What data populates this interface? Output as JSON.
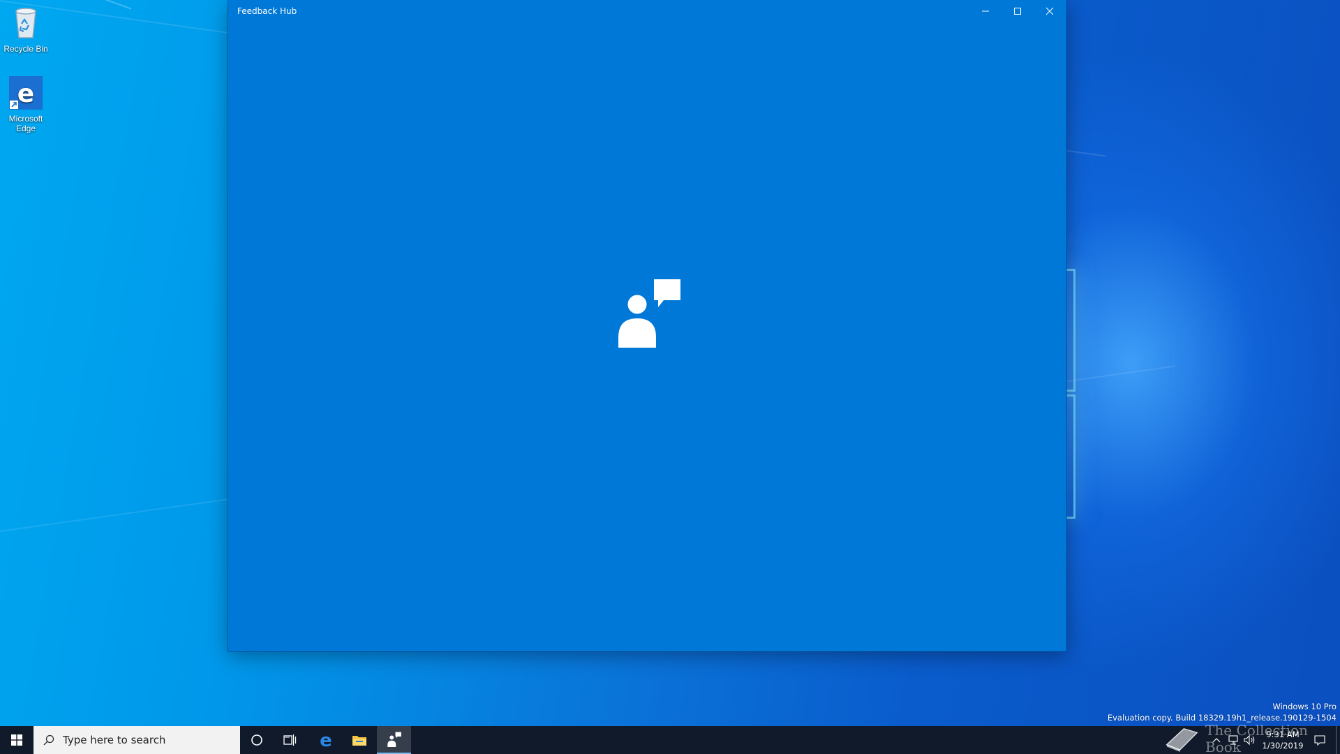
{
  "desktop": {
    "icons": [
      {
        "label": "Recycle Bin",
        "icon": "recycle-bin-icon"
      },
      {
        "label": "Microsoft Edge",
        "icon": "edge-icon"
      }
    ],
    "watermark": {
      "edition": "Windows 10 Pro",
      "build": "Evaluation copy. Build 18329.19h1_release.190129-1504"
    },
    "overlay_logo_text": "The Collection Book"
  },
  "window": {
    "title": "Feedback Hub",
    "background_color": "#0078d7",
    "buttons": {
      "minimize": "minimize-icon",
      "maximize": "maximize-icon",
      "close": "close-icon"
    },
    "splash_icon": "feedback-hub-logo-icon"
  },
  "taskbar": {
    "start_icon": "windows-start-icon",
    "search_placeholder": "Type here to search",
    "items": [
      {
        "name": "cortana",
        "icon": "cortana-circle-icon"
      },
      {
        "name": "task-view",
        "icon": "task-view-icon"
      },
      {
        "name": "edge",
        "icon": "edge-icon"
      },
      {
        "name": "file-explorer",
        "icon": "folder-icon"
      },
      {
        "name": "feedback-hub",
        "icon": "feedback-hub-icon",
        "active": true
      }
    ],
    "tray": {
      "time": "9:31 AM",
      "date": "1/30/2019",
      "icons": [
        "chevron-up-icon",
        "network-icon",
        "volume-icon",
        "notification-icon"
      ]
    }
  }
}
